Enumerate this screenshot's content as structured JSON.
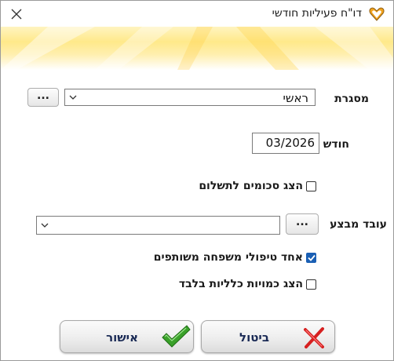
{
  "window": {
    "title": "דו\"ח פעיליות חודשי"
  },
  "form": {
    "framework_label": "מסגרת",
    "framework_value": "ראשי",
    "browse_label": "...",
    "month_label": "חודש",
    "month_value": "03/2026",
    "show_sums_label": "הצג סכומים לתשלום",
    "worker_label": "עובד מבצע",
    "worker_value": "",
    "worker_browse_label": "...",
    "unify_family_label": "אחד טיפולי משפחה משותפים",
    "totals_only_label": "הצג כמויות כלליות בלבד"
  },
  "checkboxes": {
    "show_sums": false,
    "unify_family": true,
    "totals_only": false
  },
  "buttons": {
    "cancel": "ביטול",
    "ok": "אישור"
  },
  "colors": {
    "accent": "#1a5fb4",
    "ok_icon": "#3aa12a",
    "cancel_icon": "#d62020",
    "banner": "#ffe98a"
  }
}
